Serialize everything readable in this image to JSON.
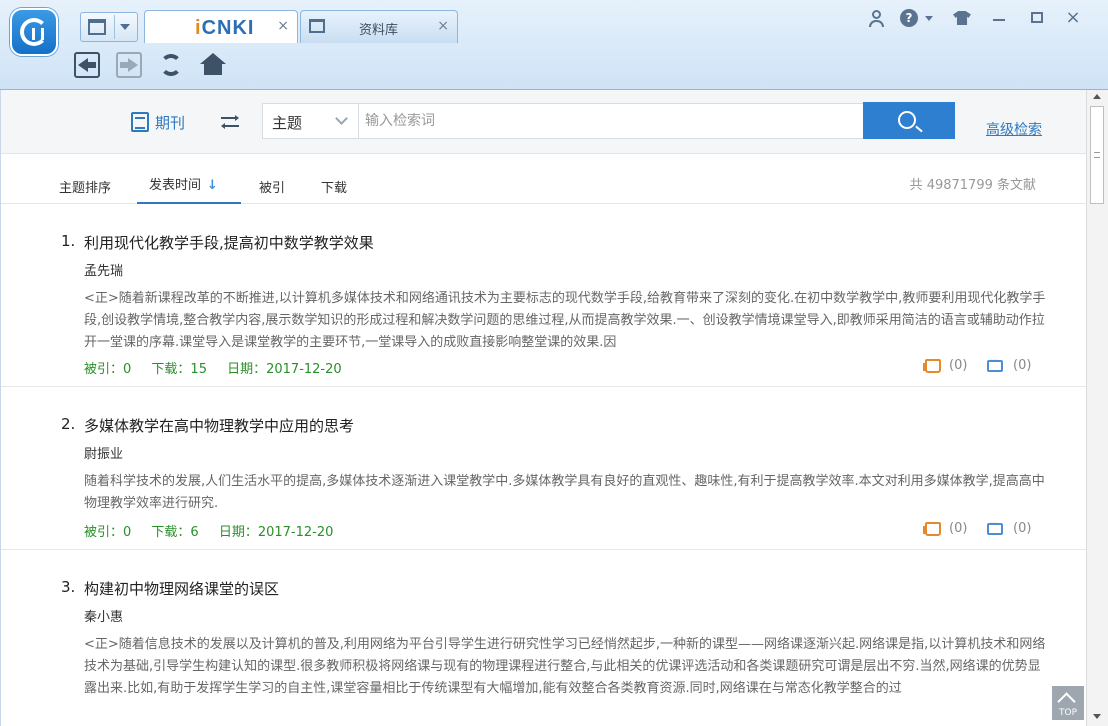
{
  "window": {
    "tabs": [
      {
        "label": "CNKI",
        "close": "×",
        "active": true
      },
      {
        "label": "资料库",
        "close": "×",
        "active": false
      }
    ],
    "close_glyph": "×"
  },
  "search": {
    "journal_label": "期刊",
    "field_value": "主题",
    "placeholder": "输入检索词",
    "advanced_label": "高级检索"
  },
  "sort": {
    "topic": "主题排序",
    "date": "发表时间",
    "date_arrow": "↓",
    "cited": "被引",
    "download": "下载",
    "total": "共 49871799 条文献"
  },
  "results": [
    {
      "index": "1.",
      "title": "利用现代化教学手段,提高初中数学教学效果",
      "author": "孟先瑞",
      "abstract": "<正>随着新课程改革的不断推进,以计算机多媒体技术和网络通讯技术为主要标志的现代数学手段,给教育带来了深刻的变化.在初中数学教学中,教师要利用现代化教学手段,创设教学情境,整合教学内容,展示数学知识的形成过程和解决数学问题的思维过程,从而提高教学效果.一、创设教学情境课堂导入,即教师采用简洁的语言或辅助动作拉开一堂课的序幕.课堂导入是课堂教学的主要环节,一堂课导入的成败直接影响整堂课的效果.因",
      "cited": "被引：0",
      "downloads": "下载：15",
      "date": "日期：2017-12-20",
      "likes": "(0)",
      "comments": "(0)"
    },
    {
      "index": "2.",
      "title": "多媒体教学在高中物理教学中应用的思考",
      "author": "尉振业",
      "abstract": "随着科学技术的发展,人们生活水平的提高,多媒体技术逐渐进入课堂教学中.多媒体教学具有良好的直观性、趣味性,有利于提高教学效率.本文对利用多媒体教学,提高高中物理教学效率进行研究.",
      "cited": "被引：0",
      "downloads": "下载：6",
      "date": "日期：2017-12-20",
      "likes": "(0)",
      "comments": "(0)"
    },
    {
      "index": "3.",
      "title": "构建初中物理网络课堂的误区",
      "author": "秦小惠",
      "abstract": "<正>随着信息技术的发展以及计算机的普及,利用网络为平台引导学生进行研究性学习已经悄然起步,一种新的课型——网络课逐渐兴起.网络课是指,以计算机技术和网络技术为基础,引导学生构建认知的课型.很多教师积极将网络课与现有的物理课程进行整合,与此相关的优课评选活动和各类课题研究可谓是层出不穷.当然,网络课的优势显露出来.比如,有助于发挥学生学习的自主性,课堂容量相比于传统课型有大幅增加,能有效整合各类教育资源.同时,网络课在与常态化教学整合的过",
      "cited": "",
      "downloads": "",
      "date": "",
      "likes": "",
      "comments": ""
    }
  ],
  "top_button": "TOP",
  "colors": {
    "accent": "#2f7fd1",
    "link": "#2f79c0",
    "meta_green": "#2a8f2a",
    "like_orange": "#e48a2a"
  }
}
